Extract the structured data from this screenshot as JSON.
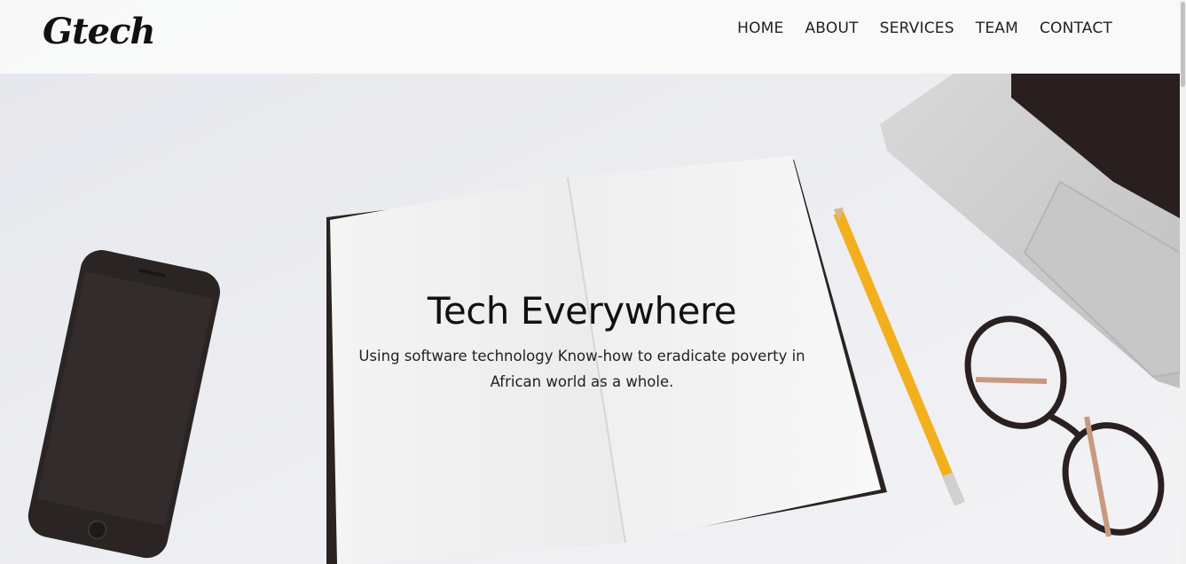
{
  "header": {
    "logo_text": "Gtech",
    "nav": [
      {
        "label": "HOME"
      },
      {
        "label": "ABOUT"
      },
      {
        "label": "SERVICES"
      },
      {
        "label": "TEAM"
      },
      {
        "label": "CONTACT"
      }
    ]
  },
  "hero": {
    "title": "Tech Everywhere",
    "subtitle": "Using software technology Know-how to eradicate poverty in African world as a whole."
  },
  "colors": {
    "header_bg": "#fafafa",
    "text": "#111111",
    "pencil": "#f2b01e"
  }
}
